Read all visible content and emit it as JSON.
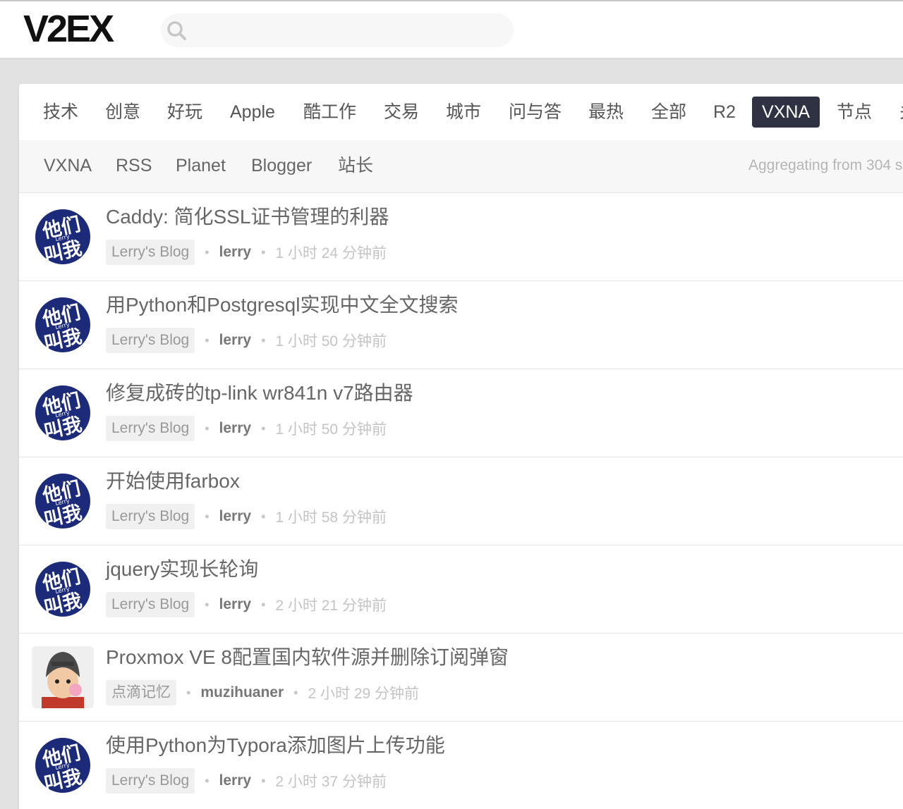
{
  "header": {
    "logo": "V2EX",
    "search_placeholder": ""
  },
  "tabs": [
    {
      "label": "技术",
      "active": false
    },
    {
      "label": "创意",
      "active": false
    },
    {
      "label": "好玩",
      "active": false
    },
    {
      "label": "Apple",
      "active": false
    },
    {
      "label": "酷工作",
      "active": false
    },
    {
      "label": "交易",
      "active": false
    },
    {
      "label": "城市",
      "active": false
    },
    {
      "label": "问与答",
      "active": false
    },
    {
      "label": "最热",
      "active": false
    },
    {
      "label": "全部",
      "active": false
    },
    {
      "label": "R2",
      "active": false
    },
    {
      "label": "VXNA",
      "active": true
    },
    {
      "label": "节点",
      "active": false
    },
    {
      "label": "关",
      "active": false
    }
  ],
  "subtabs": [
    {
      "label": "VXNA"
    },
    {
      "label": "RSS"
    },
    {
      "label": "Planet"
    },
    {
      "label": "Blogger"
    },
    {
      "label": "站长"
    }
  ],
  "aggregating": "Aggregating from 304 s",
  "entries": [
    {
      "title": "Caddy: 简化SSL证书管理的利器",
      "source": "Lerry's Blog",
      "author": "lerry",
      "time": "1 小时 24 分钟前",
      "avatar": "lerry-avatar"
    },
    {
      "title": "用Python和Postgresql实现中文全文搜索",
      "source": "Lerry's Blog",
      "author": "lerry",
      "time": "1 小时 50 分钟前",
      "avatar": "lerry-avatar"
    },
    {
      "title": "修复成砖的tp-link wr841n v7路由器",
      "source": "Lerry's Blog",
      "author": "lerry",
      "time": "1 小时 50 分钟前",
      "avatar": "lerry-avatar"
    },
    {
      "title": "开始使用farbox",
      "source": "Lerry's Blog",
      "author": "lerry",
      "time": "1 小时 58 分钟前",
      "avatar": "lerry-avatar"
    },
    {
      "title": "jquery实现长轮询",
      "source": "Lerry's Blog",
      "author": "lerry",
      "time": "2 小时 21 分钟前",
      "avatar": "lerry-avatar"
    },
    {
      "title": "Proxmox VE 8配置国内软件源并删除订阅弹窗",
      "source": "点滴记忆",
      "author": "muzihuaner",
      "time": "2 小时 29 分钟前",
      "avatar": "muzihuaner-avatar"
    },
    {
      "title": "使用Python为Typora添加图片上传功能",
      "source": "Lerry's Blog",
      "author": "lerry",
      "time": "2 小时 37 分钟前",
      "avatar": "lerry-avatar"
    }
  ],
  "avatar_text": {
    "top": "他们",
    "bottom": "叫我",
    "small": "Lerry"
  }
}
